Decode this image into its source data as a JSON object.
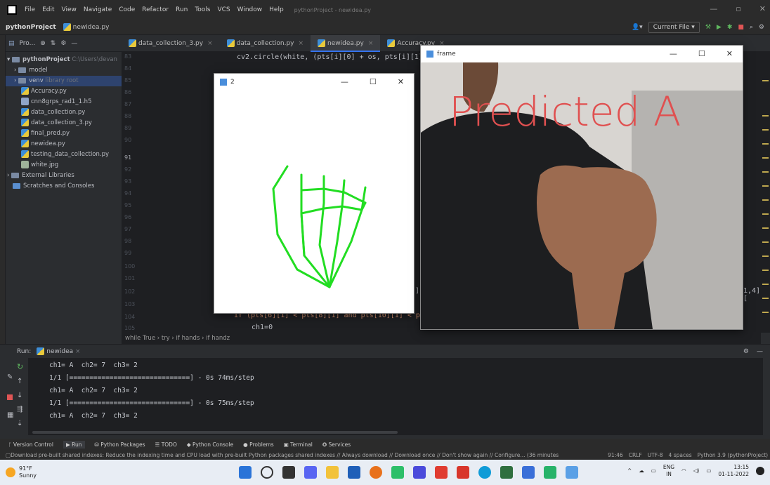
{
  "menu": {
    "items": [
      "File",
      "Edit",
      "View",
      "Navigate",
      "Code",
      "Refactor",
      "Run",
      "Tools",
      "VCS",
      "Window",
      "Help"
    ],
    "window_title": "pythonProject - newidea.py"
  },
  "nav": {
    "project": "pythonProject",
    "file": "newidea.py",
    "config": "Current File ▾"
  },
  "project_panel": {
    "title": "Pro...",
    "root": "pythonProject",
    "root_path": "C:\\Users\\devan",
    "items": [
      {
        "label": "model"
      },
      {
        "label": "venv",
        "hint": "library root"
      },
      {
        "label": "Accuracy.py"
      },
      {
        "label": "cnn8grps_rad1_1.h5"
      },
      {
        "label": "data_collection.py"
      },
      {
        "label": "data_collection_3.py"
      },
      {
        "label": "final_pred.py"
      },
      {
        "label": "newidea.py"
      },
      {
        "label": "testing_data_collection.py"
      },
      {
        "label": "white.jpg"
      },
      {
        "label": "External Libraries"
      },
      {
        "label": "Scratches and Consoles"
      }
    ]
  },
  "tabs": [
    "data_collection_3.py",
    "data_collection.py",
    "newidea.py",
    "Accuracy.py"
  ],
  "editor": {
    "lines": [
      "83",
      "84",
      "85",
      "86",
      "87",
      "88",
      "89",
      "90",
      "91",
      "92",
      "93",
      "94",
      "95",
      "96",
      "97",
      "98",
      "99",
      "100",
      "101",
      "102",
      "103",
      "104",
      "105"
    ],
    "code_top": "cv2.circle(white, (pts[i][0] + os, pts[i][1]",
    "code_bottom": "if (pts[6][1] < pts[8][1] and pts[10][1] < pts",
    "code_last": "ch1=0",
    "right_frag": "1,4],[",
    "mid_frag": "]"
  },
  "breadcrumbs": "while True  ›  try  ›  if hands  ›  if handz",
  "run": {
    "label": "Run:",
    "config": "newidea"
  },
  "console": [
    "ch1= A  ch2= 7  ch3= 2",
    "1/1 [==============================] - 0s 74ms/step",
    "ch1= A  ch2= 7  ch3= 2",
    "1/1 [==============================] - 0s 75ms/step",
    "ch1= A  ch2= 7  ch3= 2"
  ],
  "toolwindows": [
    "Version Control",
    "Run",
    "Python Packages",
    "TODO",
    "Python Console",
    "Problems",
    "Terminal",
    "Services"
  ],
  "status": {
    "msg": "Download pre-built shared indexes: Reduce the indexing time and CPU load with pre-built Python packages shared indexes // Always download // Download once // Don't show again // Configure... (36 minutes",
    "pos": "91:46",
    "crlf": "CRLF",
    "enc": "UTF-8",
    "indent": "4 spaces",
    "interp": "Python 3.9 (pythonProject)"
  },
  "win2": {
    "title": "2"
  },
  "frame": {
    "title": "frame",
    "predicted": "Predicted A"
  },
  "taskbar": {
    "temp": "91°F",
    "cond": "Sunny",
    "lang1": "ENG",
    "lang2": "IN",
    "time": "13:15",
    "date": "01-11-2022"
  }
}
